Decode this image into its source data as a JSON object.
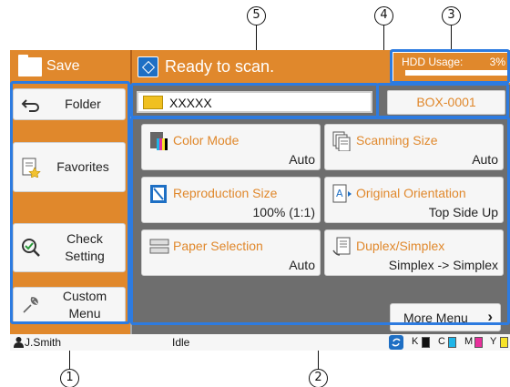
{
  "callouts": [
    {
      "number": "1"
    },
    {
      "number": "2"
    },
    {
      "number": "3"
    },
    {
      "number": "4"
    },
    {
      "number": "5"
    }
  ],
  "header": {
    "mode_label": "Save",
    "status_text": "Ready to scan.",
    "hdd_label": "HDD Usage:",
    "hdd_percent": "3%",
    "hdd_usage_fraction": 0.03
  },
  "sidebar": {
    "items": [
      {
        "label": "Folder",
        "icon": "back-arrow-icon"
      },
      {
        "label": "Favorites",
        "icon": "favorites-icon"
      },
      {
        "label": "Check Setting",
        "icon": "check-setting-icon"
      },
      {
        "label": "Custom Menu",
        "icon": "wrench-icon"
      }
    ]
  },
  "main": {
    "folder_value": "XXXXX",
    "box_button": "BOX-0001",
    "functions": [
      {
        "title": "Color Mode",
        "value": "Auto",
        "icon": "color-mode-icon"
      },
      {
        "title": "Scanning Size",
        "value": "Auto",
        "icon": "scanning-size-icon"
      },
      {
        "title": "Reproduction Size",
        "value": "100% (1:1)",
        "icon": "reproduction-size-icon"
      },
      {
        "title": "Original Orientation",
        "value": "Top Side Up",
        "icon": "orientation-icon"
      },
      {
        "title": "Paper Selection",
        "value": "Auto",
        "icon": "paper-tray-icon"
      },
      {
        "title": "Duplex/Simplex",
        "value": "Simplex -> Simplex",
        "icon": "duplex-icon"
      }
    ],
    "more_menu": "More Menu",
    "more_menu_icon": "chevron-right-icon"
  },
  "statusbar": {
    "user": "J.Smith",
    "status": "Idle",
    "ink_labels": [
      "K",
      "C",
      "M",
      "Y"
    ],
    "ink_colors": [
      "#111111",
      "#1fb5e8",
      "#e8309c",
      "#f7e32a"
    ]
  },
  "colors": {
    "accent": "#e0882c",
    "outline": "#2d7be0",
    "panel": "#6e6e6e"
  }
}
